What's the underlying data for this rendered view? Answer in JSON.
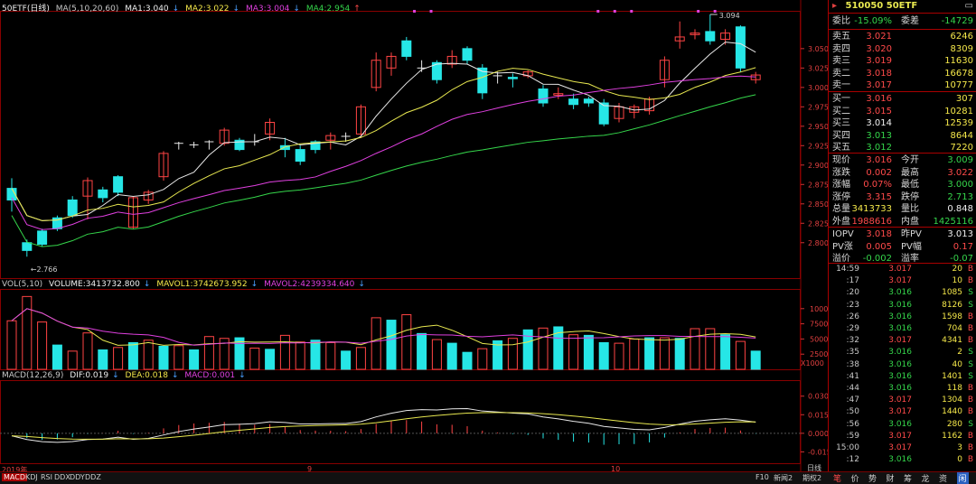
{
  "main_chart": {
    "title": "50ETF(日线)",
    "ma_label": "MA(5,10,20,60)",
    "ma1": "MA1:3.040",
    "ma2": "MA2:3.022",
    "ma3": "MA3:3.004",
    "ma4": "MA4:2.954",
    "high_mark": "3.094",
    "low_mark": "2.766",
    "price_axis": [
      "3.050",
      "3.025",
      "3.000",
      "2.975",
      "2.950",
      "2.925",
      "2.900",
      "2.875",
      "2.850",
      "2.825",
      "2.800"
    ],
    "candles": [
      [
        2.855,
        2.87,
        2.84,
        2.883,
        "up"
      ],
      [
        2.79,
        2.8,
        2.782,
        2.804,
        "up"
      ],
      [
        2.798,
        2.815,
        2.795,
        2.818,
        "up"
      ],
      [
        2.818,
        2.832,
        2.815,
        2.835,
        "up"
      ],
      [
        2.835,
        2.855,
        2.832,
        2.86,
        "up"
      ],
      [
        2.86,
        2.88,
        2.83,
        2.884,
        "down"
      ],
      [
        2.868,
        2.858,
        2.852,
        2.872,
        "up"
      ],
      [
        2.865,
        2.885,
        2.86,
        2.887,
        "up"
      ],
      [
        2.858,
        2.82,
        2.818,
        2.86,
        "down"
      ],
      [
        2.855,
        2.865,
        2.85,
        2.868,
        "down"
      ],
      [
        2.885,
        2.915,
        2.88,
        2.918,
        "down"
      ],
      [
        2.925,
        2.928,
        2.92,
        2.93,
        "cross"
      ],
      [
        2.925,
        2.926,
        2.922,
        2.93,
        "cross"
      ],
      [
        2.922,
        2.93,
        2.92,
        2.932,
        "cross"
      ],
      [
        2.928,
        2.945,
        2.925,
        2.948,
        "down"
      ],
      [
        2.932,
        2.92,
        2.918,
        2.935,
        "up"
      ],
      [
        2.935,
        2.93,
        2.925,
        2.94,
        "cross"
      ],
      [
        2.94,
        2.955,
        2.932,
        2.96,
        "down"
      ],
      [
        2.925,
        2.92,
        2.91,
        2.935,
        "up"
      ],
      [
        2.92,
        2.905,
        2.9,
        2.925,
        "up"
      ],
      [
        2.92,
        2.93,
        2.915,
        2.932,
        "up"
      ],
      [
        2.932,
        2.938,
        2.92,
        2.942,
        "down"
      ],
      [
        2.938,
        2.937,
        2.93,
        2.942,
        "cross"
      ],
      [
        2.94,
        2.975,
        2.935,
        2.978,
        "down"
      ],
      [
        3.0,
        3.035,
        2.995,
        3.045,
        "down"
      ],
      [
        3.025,
        3.04,
        3.015,
        3.045,
        "down"
      ],
      [
        3.06,
        3.04,
        3.035,
        3.065,
        "up"
      ],
      [
        3.03,
        3.025,
        3.02,
        3.035,
        "cross"
      ],
      [
        3.032,
        3.01,
        3.005,
        3.035,
        "up"
      ],
      [
        3.03,
        3.04,
        3.025,
        3.048,
        "down"
      ],
      [
        3.05,
        3.035,
        3.03,
        3.053,
        "up"
      ],
      [
        3.025,
        2.993,
        2.985,
        3.03,
        "up"
      ],
      [
        3.01,
        3.015,
        3.005,
        3.02,
        "cross"
      ],
      [
        3.012,
        3.013,
        3.0,
        3.018,
        "up"
      ],
      [
        3.015,
        3.02,
        3.012,
        3.022,
        "down"
      ],
      [
        2.998,
        2.98,
        2.975,
        3.003,
        "up"
      ],
      [
        2.99,
        2.992,
        2.985,
        3.0,
        "down"
      ],
      [
        2.985,
        2.978,
        2.972,
        2.992,
        "up"
      ],
      [
        2.985,
        2.98,
        2.975,
        2.988,
        "up"
      ],
      [
        2.98,
        2.953,
        2.95,
        2.985,
        "up"
      ],
      [
        2.96,
        2.975,
        2.955,
        2.98,
        "down"
      ],
      [
        2.975,
        2.968,
        2.96,
        2.978,
        "down"
      ],
      [
        2.97,
        2.985,
        2.965,
        2.988,
        "down"
      ],
      [
        3.01,
        3.035,
        3.0,
        3.04,
        "down"
      ],
      [
        3.06,
        3.065,
        3.05,
        3.085,
        "down"
      ],
      [
        3.068,
        3.07,
        3.062,
        3.075,
        "down"
      ],
      [
        3.072,
        3.06,
        3.055,
        3.094,
        "up"
      ],
      [
        3.07,
        3.062,
        3.055,
        3.075,
        "down"
      ],
      [
        3.078,
        3.025,
        3.02,
        3.08,
        "up"
      ],
      [
        3.016,
        3.01,
        3.005,
        3.02,
        "down"
      ]
    ]
  },
  "vol_chart": {
    "label": "VOL(5,10)",
    "volume": "VOLUME:3413732.800",
    "mavol1": "MAVOL1:3742673.952",
    "mavol2": "MAVOL2:4239334.640",
    "axis": [
      "10000",
      "7500",
      "5000",
      "2500"
    ],
    "unit": "X1000",
    "bars": [
      8000,
      12000,
      7800,
      4000,
      3000,
      6000,
      3200,
      3600,
      4400,
      4800,
      3800,
      3900,
      3200,
      5400,
      5100,
      5200,
      3500,
      3300,
      5600,
      4500,
      4800,
      4400,
      3000,
      3600,
      8500,
      8100,
      9000,
      5900,
      4900,
      4300,
      2800,
      3400,
      4700,
      5100,
      6500,
      6800,
      7000,
      5700,
      5600,
      4400,
      4300,
      5000,
      5200,
      5200,
      5100,
      6700,
      6700,
      5700,
      4600,
      3000
    ],
    "colors": [
      "down",
      "down",
      "down",
      "up",
      "down",
      "down",
      "up",
      "down",
      "up",
      "down",
      "up",
      "down",
      "up",
      "down",
      "down",
      "up",
      "down",
      "up",
      "down",
      "down",
      "up",
      "down",
      "up",
      "down",
      "down",
      "up",
      "down",
      "up",
      "down",
      "up",
      "up",
      "down",
      "up",
      "down",
      "up",
      "down",
      "up",
      "down",
      "up",
      "up",
      "down",
      "down",
      "up",
      "down",
      "up",
      "down",
      "down",
      "up",
      "down",
      "up"
    ]
  },
  "macd_chart": {
    "label": "MACD(12,26,9)",
    "dif": "DIF:0.019",
    "dea": "DEA:0.018",
    "macd": "MACD:0.001",
    "axis": [
      "0.030",
      "0.015",
      "0.000",
      "-0.015"
    ]
  },
  "xaxis": {
    "d1": "2019年",
    "d2": "9",
    "d3": "10"
  },
  "bottom_tabs": {
    "macd": "MACD",
    "kdj": "KDJ",
    "rsi": "RSI",
    "ddx": "DDX",
    "ddy": "DDY",
    "ddz": "DDZ",
    "f10": "F10",
    "news": "新闻2",
    "futures": "期权2",
    "daily": "日线"
  },
  "side": {
    "code": "510050",
    "name": "50ETF",
    "weibi_label": "委比",
    "weibi": "-15.09%",
    "weicha_label": "委差",
    "weicha": "-14729",
    "sells": [
      {
        "label": "卖五",
        "price": "3.021",
        "vol": "6246"
      },
      {
        "label": "卖四",
        "price": "3.020",
        "vol": "8309"
      },
      {
        "label": "卖三",
        "price": "3.019",
        "vol": "11630"
      },
      {
        "label": "卖二",
        "price": "3.018",
        "vol": "16678"
      },
      {
        "label": "卖一",
        "price": "3.017",
        "vol": "10777"
      }
    ],
    "buys": [
      {
        "label": "买一",
        "price": "3.016",
        "vol": "307"
      },
      {
        "label": "买二",
        "price": "3.015",
        "vol": "10281"
      },
      {
        "label": "买三",
        "price": "3.014",
        "vol": "12539"
      },
      {
        "label": "买四",
        "price": "3.013",
        "vol": "8644"
      },
      {
        "label": "买五",
        "price": "3.012",
        "vol": "7220"
      }
    ],
    "stats": [
      {
        "l1": "现价",
        "v1": "3.016",
        "c1": "red",
        "l2": "今开",
        "v2": "3.009",
        "c2": "green"
      },
      {
        "l1": "涨跌",
        "v1": "0.002",
        "c1": "red",
        "l2": "最高",
        "v2": "3.022",
        "c2": "red"
      },
      {
        "l1": "涨幅",
        "v1": "0.07%",
        "c1": "red",
        "l2": "最低",
        "v2": "3.000",
        "c2": "green"
      },
      {
        "l1": "涨停",
        "v1": "3.315",
        "c1": "red",
        "l2": "跌停",
        "v2": "2.713",
        "c2": "green"
      },
      {
        "l1": "总量",
        "v1": "3413733",
        "c1": "yellow",
        "l2": "量比",
        "v2": "0.848",
        "c2": "white"
      },
      {
        "l1": "外盘",
        "v1": "1988616",
        "c1": "red",
        "l2": "内盘",
        "v2": "1425116",
        "c2": "green"
      }
    ],
    "iopv": [
      {
        "l1": "IOPV",
        "v1": "3.018",
        "c1": "red",
        "l2": "昨PV",
        "v2": "3.013",
        "c2": "white"
      },
      {
        "l1": "PV涨",
        "v1": "0.005",
        "c1": "red",
        "l2": "PV幅",
        "v2": "0.17",
        "c2": "red"
      },
      {
        "l1": "溢价",
        "v1": "-0.002",
        "c1": "green",
        "l2": "溢率",
        "v2": "-0.07",
        "c2": "green"
      }
    ],
    "ticks": [
      {
        "t": "14:59",
        "p": "3.017",
        "q": "20",
        "s": "B"
      },
      {
        "t": ":17",
        "p": "3.017",
        "q": "10",
        "s": "B"
      },
      {
        "t": ":20",
        "p": "3.016",
        "q": "1085",
        "s": "S"
      },
      {
        "t": ":23",
        "p": "3.016",
        "q": "8126",
        "s": "S"
      },
      {
        "t": ":26",
        "p": "3.016",
        "q": "1598",
        "s": "B"
      },
      {
        "t": ":29",
        "p": "3.016",
        "q": "704",
        "s": "B"
      },
      {
        "t": ":32",
        "p": "3.017",
        "q": "4341",
        "s": "B"
      },
      {
        "t": ":35",
        "p": "3.016",
        "q": "2",
        "s": "S"
      },
      {
        "t": ":38",
        "p": "3.016",
        "q": "40",
        "s": "S"
      },
      {
        "t": ":41",
        "p": "3.016",
        "q": "1401",
        "s": "S"
      },
      {
        "t": ":44",
        "p": "3.016",
        "q": "118",
        "s": "B"
      },
      {
        "t": ":47",
        "p": "3.017",
        "q": "1304",
        "s": "B"
      },
      {
        "t": ":50",
        "p": "3.017",
        "q": "1440",
        "s": "B"
      },
      {
        "t": ":56",
        "p": "3.016",
        "q": "280",
        "s": "S"
      },
      {
        "t": ":59",
        "p": "3.017",
        "q": "1162",
        "s": "B"
      },
      {
        "t": "15:00",
        "p": "3.017",
        "q": "3",
        "s": "B"
      },
      {
        "t": ":12",
        "p": "3.016",
        "q": "0",
        "s": "B"
      }
    ],
    "tabs": [
      "笔",
      "价",
      "势",
      "财",
      "筹",
      "龙",
      "资",
      "闲"
    ]
  }
}
